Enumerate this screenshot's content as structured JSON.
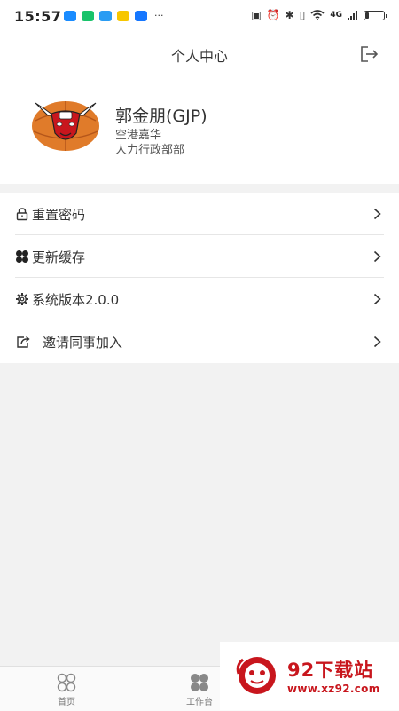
{
  "status_bar": {
    "time": "15:57",
    "dots": "···",
    "network": "4G",
    "battery_level": 0.2,
    "app_icon_colors": [
      "#1a8cff",
      "#19c36b",
      "#2a9cf3",
      "#f7c600",
      "#1677ff"
    ]
  },
  "header": {
    "title": "个人中心"
  },
  "profile": {
    "name": "郭金朋(GJP)",
    "company": "空港嘉华",
    "department": "人力行政部部"
  },
  "menu": {
    "items": [
      {
        "label": "重置密码",
        "icon": "lock-icon"
      },
      {
        "label": "更新缓存",
        "icon": "clover-icon"
      },
      {
        "label": "系统版本2.0.0",
        "icon": "gear-icon"
      },
      {
        "label": "邀请同事加入",
        "icon": "share-icon"
      }
    ]
  },
  "bottom_nav": {
    "items": [
      {
        "label": "首页",
        "icon": "home-icon"
      },
      {
        "label": "工作台",
        "icon": "workbench-icon"
      }
    ]
  },
  "watermark": {
    "title": "92下载站",
    "url": "www.xz92.com"
  },
  "colors": {
    "background": "#f2f2f2",
    "panel": "#ffffff",
    "text": "#333333",
    "watermark_red": "#c8161d"
  }
}
